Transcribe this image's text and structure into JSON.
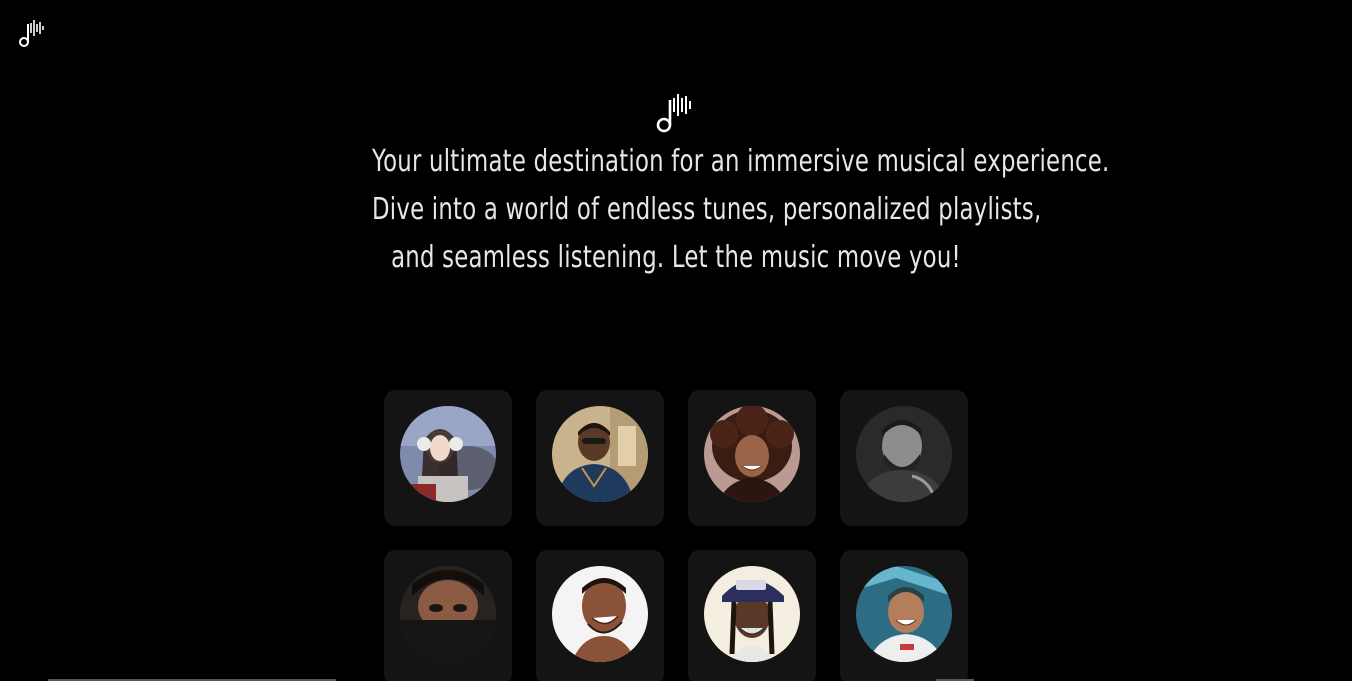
{
  "brand": {
    "logo_icon": "music-note-waveform-icon"
  },
  "hero": {
    "icon": "music-note-waveform-icon",
    "tagline_lines": [
      "Your ultimate destination for an immersive musical experience.",
      "Dive into a world of endless tunes, personalized playlists,",
      "and seamless listening. Let the music move you!"
    ]
  },
  "artists": [
    {
      "avatar": "artist-photo-1",
      "bg": "#7a86a8"
    },
    {
      "avatar": "artist-photo-2",
      "bg": "#c9b28a"
    },
    {
      "avatar": "artist-photo-3",
      "bg": "#b58f86"
    },
    {
      "avatar": "artist-photo-4",
      "bg": "#3a3a3a"
    },
    {
      "avatar": "artist-photo-5",
      "bg": "#3d3f38"
    },
    {
      "avatar": "artist-photo-6",
      "bg": "#f2f2f2"
    },
    {
      "avatar": "artist-photo-7",
      "bg": "#f3eddf"
    },
    {
      "avatar": "artist-photo-8",
      "bg": "#2f6f86"
    }
  ],
  "colors": {
    "background": "#000000",
    "card": "#141414",
    "text": "#e6e6e6"
  }
}
